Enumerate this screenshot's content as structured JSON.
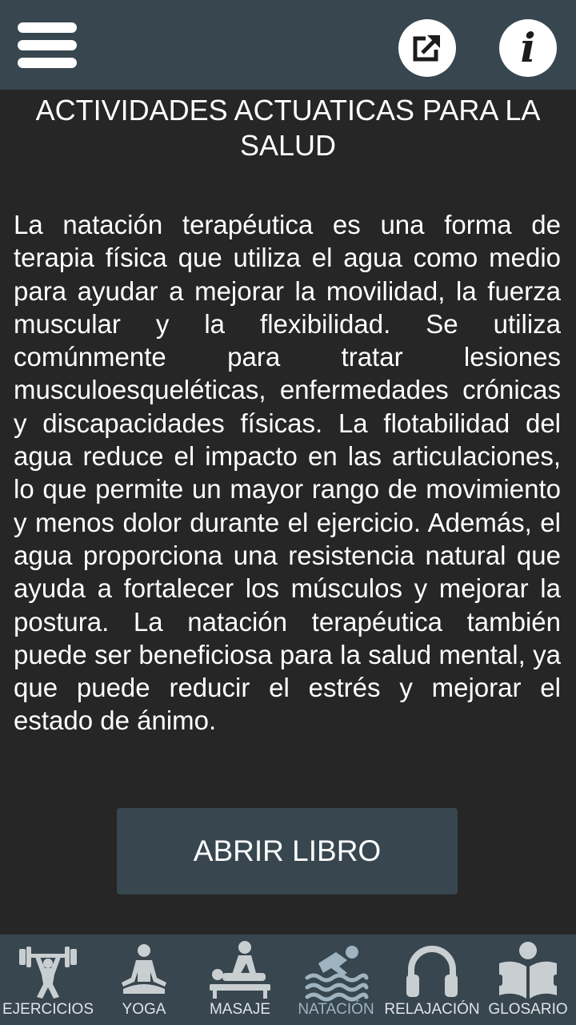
{
  "header": {
    "menu_icon": "hamburger-menu-icon",
    "share_icon": "external-link-icon",
    "info_icon": "info-icon",
    "info_glyph": "i"
  },
  "content": {
    "title": "ACTIVIDADES ACTUATICAS PARA LA SALUD",
    "body": "La natación terapéutica es una forma de terapia física que utiliza el agua como medio para ayudar a mejorar la movilidad, la fuerza muscular y la flexibilidad. Se utiliza comúnmente para tratar lesiones musculoesqueléticas, enfermedades crónicas y discapacidades físicas. La flotabilidad del agua reduce el impacto en las articulaciones, lo que permite un mayor rango de movimiento y menos dolor durante el ejercicio. Además, el agua proporciona una resistencia natural que ayuda a fortalecer los músculos y mejorar la postura. La natación terapéutica también puede ser beneficiosa para la salud mental, ya que puede reducir el estrés y mejorar el estado de ánimo.",
    "open_button": "ABRIR LIBRO"
  },
  "bottom_nav": [
    {
      "label": "EJERCICIOS",
      "icon": "weightlifter-icon"
    },
    {
      "label": "YOGA",
      "icon": "meditation-icon"
    },
    {
      "label": "MASAJE",
      "icon": "massage-icon"
    },
    {
      "label": "NATACIÓN",
      "icon": "swimmer-icon",
      "active": true
    },
    {
      "label": "RELAJACIÓN",
      "icon": "headphones-icon"
    },
    {
      "label": "GLOSARIO",
      "icon": "book-reader-icon"
    }
  ],
  "colors": {
    "background": "#262626",
    "bar": "#37464f",
    "text": "#ffffff",
    "icon": "#c9ced1",
    "active": "#9fb3c0"
  }
}
